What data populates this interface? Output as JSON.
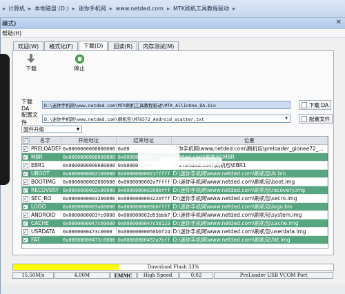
{
  "breadcrumb": [
    "计算机",
    "本地磁盘 (D:)",
    "迷你手机网",
    "www.netded.com",
    "MTK刷机工具教程驱动"
  ],
  "window": {
    "title": "模式)",
    "close_glyph": "✕"
  },
  "menu": [
    "帮助(H)"
  ],
  "tabs": [
    {
      "label": "欢迎(W)",
      "active": false
    },
    {
      "label": "格式化(F)",
      "active": false
    },
    {
      "label": "下载(D)",
      "active": true
    },
    {
      "label": "回读(R)",
      "active": false
    },
    {
      "label": "内存测试(M)",
      "active": false
    }
  ],
  "toolbar": {
    "download": "下载",
    "stop": "停止"
  },
  "download_agent": {
    "label": "下载 DA",
    "value": "D:\\迷你手机网\\www.netded.com\\MTK刷机工具教程驱动\\MTK_AllInOne_DA.bin",
    "button": "下载 DA"
  },
  "scatter": {
    "label": "配置文件",
    "value": "D:\\迷你手机网\\www.netded.com\\刷机包\\MT6572_Android_scatter.txt",
    "button": "配置文件"
  },
  "mode_select": {
    "value": "固件升级"
  },
  "table": {
    "columns": [
      "名字",
      "开始地址",
      "结束地址",
      "位置"
    ],
    "rows": [
      {
        "checked": true,
        "name": "PRELOADER",
        "begin": "0x0000000000000000",
        "end": "0x00",
        "location": "迷你手机网\\www.netded.com\\刷机包\\preloader_gionee72_...",
        "style": "white"
      },
      {
        "checked": true,
        "name": "MBR",
        "begin": "0x0000000000600000",
        "end": "0x0000000000",
        "location": "netded.com\\刷机包\\MBR",
        "style": "green"
      },
      {
        "checked": true,
        "name": "EBR1",
        "begin": "0x0000000000680000",
        "end": "0x0000000000",
        "location": "ww.netded.com\\刷机包\\EBR1",
        "style": "white"
      },
      {
        "checked": true,
        "name": "UBOOT",
        "begin": "0x0000000002160000",
        "end": "0x00000000021fffff",
        "location": "D:\\迷你手机网\\www.netded.com\\刷机包\\lk.bin",
        "style": "green"
      },
      {
        "checked": true,
        "name": "BOOTIMG",
        "begin": "0x0000000002600000",
        "end": "0x0000000002a7ffff",
        "location": "D:\\迷你手机网\\www.netded.com\\刷机包\\boot.img",
        "style": "white"
      },
      {
        "checked": true,
        "name": "RECOVERY",
        "begin": "0x0000000002c00000",
        "end": "0x000000000308bfff",
        "location": "D:\\迷你手机网\\www.netded.com\\刷机包\\recovery.img",
        "style": "green"
      },
      {
        "checked": true,
        "name": "SEC_RO",
        "begin": "0x0000000003200000",
        "end": "0x0000000003220fff",
        "location": "D:\\迷你手机网\\www.netded.com\\刷机包\\secro.img",
        "style": "white"
      },
      {
        "checked": true,
        "name": "LOGO",
        "begin": "0x0000000003a00000",
        "end": "0x0000000003b6ffff",
        "location": "D:\\迷你手机网\\www.netded.com\\刷机包\\logo.bin",
        "style": "green"
      },
      {
        "checked": true,
        "name": "ANDROID",
        "begin": "0x0000000003fc0000",
        "end": "0x000000002d93bbb7",
        "location": "D:\\迷你手机网\\www.netded.com\\刷机包\\system.img",
        "style": "white"
      },
      {
        "checked": true,
        "name": "CACHE",
        "begin": "0x0000000047c00000",
        "end": "0x0000000047c58123",
        "location": "D:\\迷你手机网\\www.netded.com\\刷机包\\cache.img",
        "style": "green"
      },
      {
        "checked": true,
        "name": "USRDATA",
        "begin": "0x0000000473c0000",
        "end": "0x00000000050b6f24f",
        "location": "D:\\迷你手机网\\www.netded.com\\刷机包\\userdata.img",
        "style": "white"
      },
      {
        "checked": true,
        "name": "FAT",
        "begin": "0x00000000473c0000",
        "end": "0x00000000452a7bff",
        "location": "D:\\迷你手机网\\www.netded.com\\刷机包\\fat.img",
        "style": "green"
      }
    ]
  },
  "progress": {
    "text": "Download Flash 33%",
    "percent": 33,
    "fill_color": "#ffff00"
  },
  "status": [
    "15.50M/s",
    "4.00M",
    "EMMC",
    "High Speed",
    "0:02",
    "PreLoader USB VCOM Port"
  ],
  "colors": {
    "row_green": "#57a680",
    "selected_file": "#cddcf0"
  }
}
